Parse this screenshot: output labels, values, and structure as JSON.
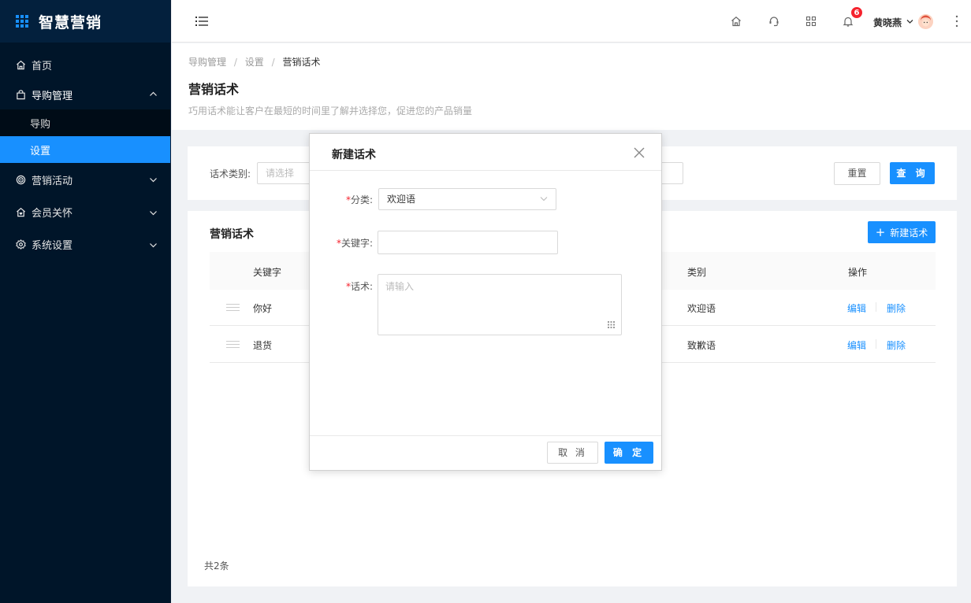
{
  "app": {
    "title": "智慧营销"
  },
  "sidebar": {
    "items": [
      {
        "label": "首页",
        "icon": "home-icon"
      },
      {
        "label": "导购管理",
        "icon": "shopping-bag-icon",
        "expanded": true,
        "children": [
          {
            "label": "导购"
          },
          {
            "label": "设置",
            "active": true
          }
        ]
      },
      {
        "label": "营销活动",
        "icon": "target-icon"
      },
      {
        "label": "会员关怀",
        "icon": "home-heart-icon"
      },
      {
        "label": "系统设置",
        "icon": "gear-icon"
      }
    ]
  },
  "header": {
    "icons": [
      "menu-icon",
      "home-icon",
      "headset-icon",
      "apps-grid-icon",
      "bell-icon",
      "more-vertical-icon"
    ],
    "notification_count": "6",
    "username": "黄晓燕"
  },
  "page": {
    "breadcrumb": [
      "导购管理",
      "设置",
      "营销话术"
    ],
    "title": "营销话术",
    "description": "巧用话术能让客户在最短的时间里了解并选择您，促进您的产品销量"
  },
  "filter": {
    "label": "话术类别:",
    "placeholder": "请选择",
    "reset_label": "重置",
    "query_label": "查 询"
  },
  "table": {
    "title": "营销话术",
    "new_button": "新建话术",
    "columns": [
      "关键字",
      "类别",
      "操作"
    ],
    "rows": [
      {
        "keyword": "你好",
        "category": "欢迎语"
      },
      {
        "keyword": "退货",
        "category": "致歉语"
      }
    ],
    "actions": {
      "edit": "编辑",
      "delete": "删除"
    },
    "total": "共2条"
  },
  "modal": {
    "title": "新建话术",
    "fields": {
      "category": {
        "required": "*",
        "label": "分类:",
        "value": "欢迎语"
      },
      "keyword": {
        "required": "*",
        "label": "关键字:",
        "value": ""
      },
      "content": {
        "required": "*",
        "label": "话术:",
        "placeholder": "请输入"
      }
    },
    "cancel_label": "取 消",
    "ok_label": "确 定"
  },
  "colors": {
    "primary": "#1890ff",
    "sidebar_bg": "#001529",
    "danger": "#f5222d"
  }
}
